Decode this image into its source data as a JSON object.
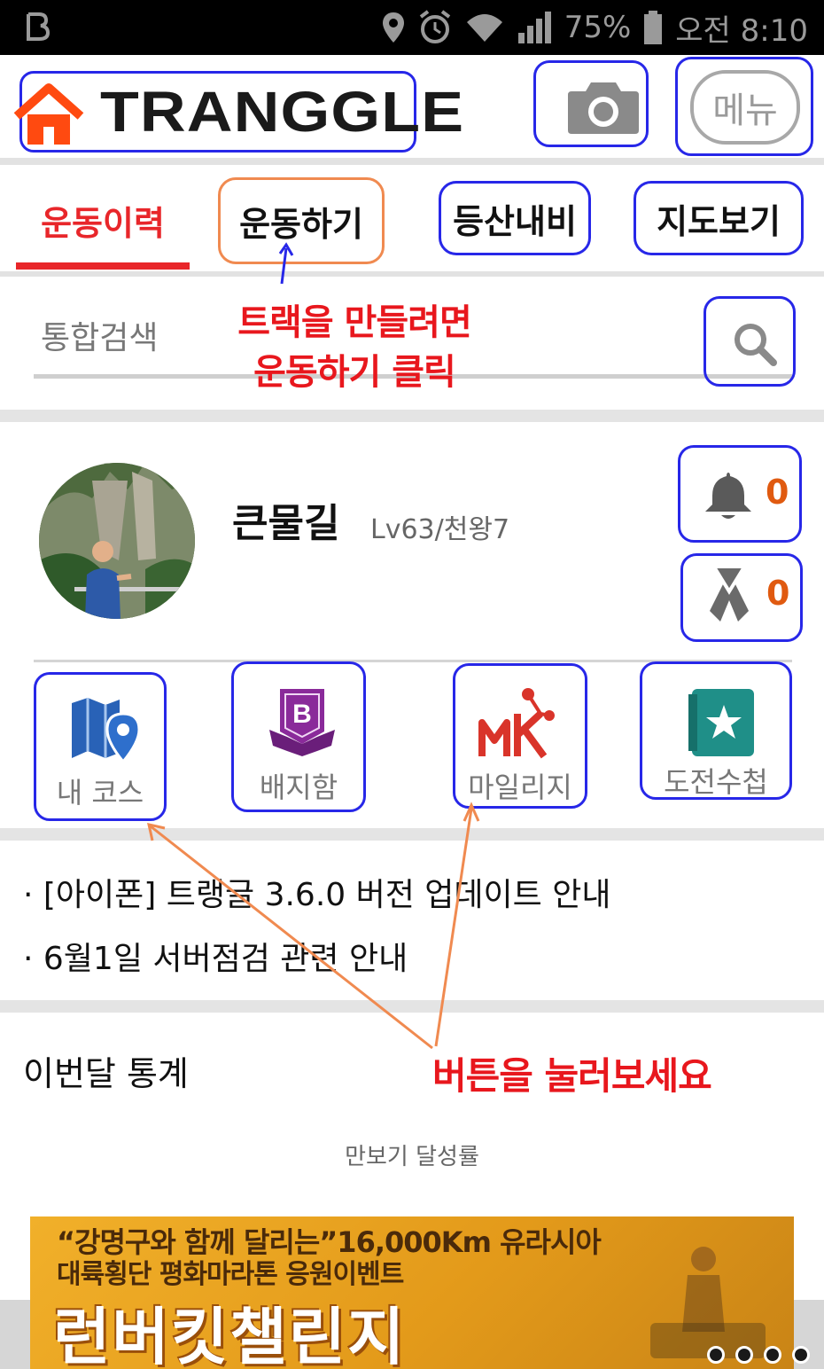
{
  "status_bar": {
    "battery": "75%",
    "time": "오전 8:10",
    "icons": [
      "app-b-icon",
      "location-icon",
      "alarm-icon",
      "wifi-icon",
      "signal-icon",
      "battery-icon"
    ]
  },
  "header": {
    "logo_text": "TRANGGLE",
    "menu_label": "메뉴",
    "icons": [
      "home-icon",
      "camera-icon"
    ]
  },
  "tabs": [
    {
      "label": "운동이력",
      "active": true
    },
    {
      "label": "운동하기",
      "active": false
    },
    {
      "label": "등산내비",
      "active": false
    },
    {
      "label": "지도보기",
      "active": false
    }
  ],
  "search": {
    "placeholder": "통합검색"
  },
  "annotations": {
    "make_track_line1": "트랙을 만들려면",
    "make_track_line2": "운동하기 클릭",
    "press_buttons": "버튼을 눌러보세요"
  },
  "profile": {
    "nickname": "큰물길",
    "level": "Lv63/천왕7",
    "notifications": "0",
    "ribbons": "0"
  },
  "quick_menu": [
    {
      "label": "내 코스",
      "icon": "course-map-icon"
    },
    {
      "label": "배지함",
      "icon": "badge-icon"
    },
    {
      "label": "마일리지",
      "icon": "mileage-icon"
    },
    {
      "label": "도전수첩",
      "icon": "challenge-book-icon"
    }
  ],
  "notices": [
    "· [아이폰] 트랭글 3.6.0 버전 업데이트 안내",
    "· 6월1일 서버점검 관련 안내"
  ],
  "stats": {
    "title": "이번달 통계",
    "subtitle": "만보기 달성률"
  },
  "banner": {
    "line1": "“강명구와 함께 달리는”16,000Km 유라시아",
    "line2": "대륙횡단 평화마라톤 응원이벤트",
    "line3": "런버킷챌린지"
  },
  "colors": {
    "accent_red": "#e8262a",
    "annotation_blue": "#2727e8",
    "annotation_orange": "#f08a50",
    "count_orange": "#e05a10"
  }
}
